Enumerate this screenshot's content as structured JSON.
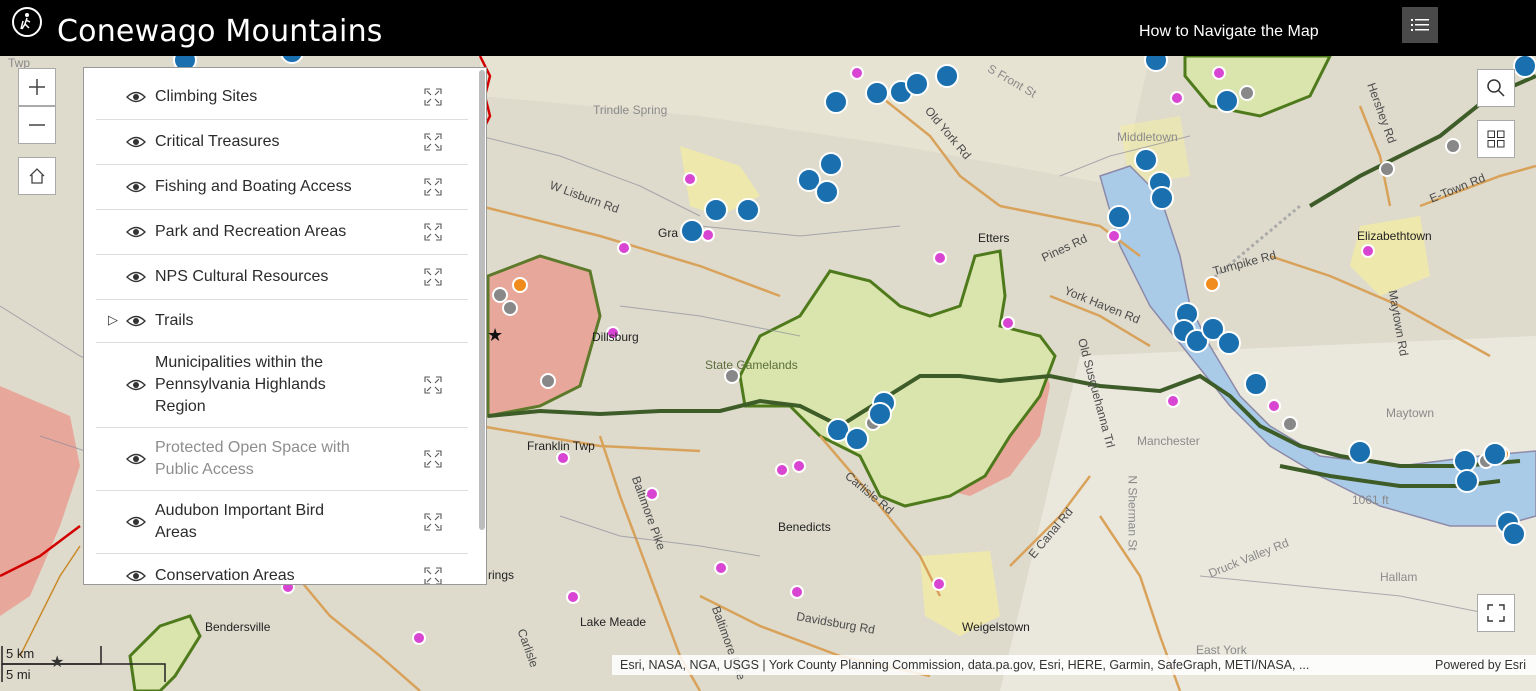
{
  "header": {
    "title": "Conewago Mountains",
    "nav_link": "How to Navigate the Map"
  },
  "layers": [
    {
      "label": "Climbing Sites",
      "visible": true,
      "expandable": false,
      "dimmed": false
    },
    {
      "label": "Critical Treasures",
      "visible": true,
      "expandable": false,
      "dimmed": false
    },
    {
      "label": "Fishing and Boating Access",
      "visible": true,
      "expandable": false,
      "dimmed": false
    },
    {
      "label": "Park and Recreation Areas",
      "visible": true,
      "expandable": false,
      "dimmed": false
    },
    {
      "label": "NPS Cultural Resources",
      "visible": true,
      "expandable": false,
      "dimmed": false
    },
    {
      "label": "Trails",
      "visible": true,
      "expandable": true,
      "dimmed": false
    },
    {
      "label": "Municipalities within the Pennsylvania Highlands Region",
      "visible": true,
      "expandable": false,
      "dimmed": false
    },
    {
      "label": "Protected Open Space with Public Access",
      "visible": true,
      "expandable": false,
      "dimmed": true
    },
    {
      "label": "Audubon Important Bird Areas",
      "visible": true,
      "expandable": false,
      "dimmed": false
    },
    {
      "label": "Conservation Areas",
      "visible": true,
      "expandable": false,
      "dimmed": false
    }
  ],
  "scalebar": {
    "metric": "5 km",
    "imperial": "5 mi"
  },
  "attribution": {
    "sources": "Esri, NASA, NGA, USGS | York County Planning Commission, data.pa.gov, Esri, HERE, Garmin, SafeGraph, METI/NASA, ...",
    "powered_by": "Powered by Esri"
  },
  "map_labels": {
    "twp": "Twp",
    "trindle_spring": "Trindle Spring",
    "w_lisburn_rd": "W Lisburn Rd",
    "gra": "Gra",
    "dillsburg": "Dillsburg",
    "state_gamelands": "State Gamelands",
    "franklin_twp": "Franklin Twp",
    "baltimore_pike": "Baltimore Pike",
    "baltimore_pike_2": "Baltimore Pike",
    "benedicts": "Benedicts",
    "carlisle_rd": "Carlisle Rd",
    "davidsburg_rd": "Davidsburg Rd",
    "weigelstown": "Weigelstown",
    "bendersville": "Bendersville",
    "lake_meade": "Lake Meade",
    "rings": "rings",
    "etters": "Etters",
    "pines_rd": "Pines Rd",
    "york_haven_rd": "York Haven Rd",
    "old_susquehanna_trl": "Old Susquehanna Trl",
    "manchester": "Manchester",
    "old_york_rd": "Old York Rd",
    "s_front_st": "S Front St",
    "middletown": "Middletown",
    "elizabethtown": "Elizabethtown",
    "e_town_rd": "E-Town Rd",
    "turnpike_rd": "Turnpike Rd",
    "maytown": "Maytown",
    "maytown_rd": "Maytown Rd",
    "hershey_rd": "Hershey Rd",
    "1061_ft": "1061 ft",
    "druck_valley_rd": "Druck Valley Rd",
    "hallam": "Hallam",
    "e_canal_rd": "E Canal Rd",
    "east_york": "East York",
    "n_sherman_st": "N Sherman St",
    "carlisle": "Carlisle"
  }
}
